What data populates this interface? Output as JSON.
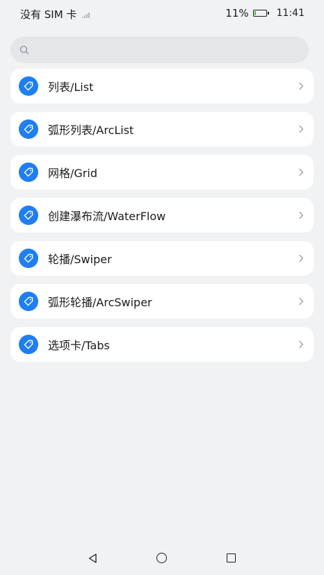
{
  "status_bar": {
    "carrier": "没有 SIM 卡",
    "battery_percent": "11%",
    "battery_level": 0.11,
    "time": "11:41"
  },
  "search": {
    "value": "",
    "placeholder": ""
  },
  "menu": {
    "items": [
      {
        "label": "列表/List"
      },
      {
        "label": "弧形列表/ArcList"
      },
      {
        "label": "网格/Grid"
      },
      {
        "label": "创建瀑布流/WaterFlow"
      },
      {
        "label": "轮播/Swiper"
      },
      {
        "label": "弧形轮播/ArcSwiper"
      },
      {
        "label": "选项卡/Tabs"
      }
    ]
  },
  "colors": {
    "accent": "#1e7ef2",
    "battery": "#37c02f",
    "background": "#f1f2f4"
  },
  "icons": {
    "item_icon": "tag-icon",
    "item_chevron": "chevron-right-icon",
    "search": "search-icon",
    "nav": [
      "back-icon",
      "home-icon",
      "recents-icon"
    ]
  }
}
